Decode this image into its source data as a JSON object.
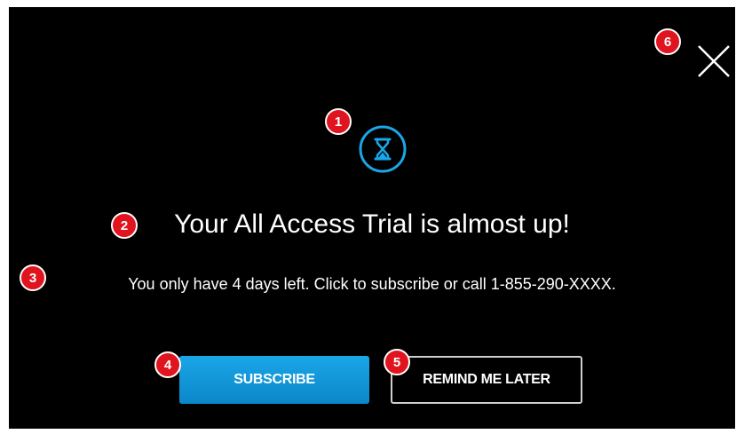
{
  "dialog": {
    "title": "Your All Access Trial is almost up!",
    "message": "You only have 4 days left. Click to subscribe or call 1-855-290-XXXX.",
    "icon": "hourglass-icon",
    "accent_color": "#1aa6e8"
  },
  "buttons": {
    "subscribe_label": "SUBSCRIBE",
    "remind_label": "REMIND ME LATER",
    "close_icon": "close-icon"
  },
  "markers": [
    "1",
    "2",
    "3",
    "4",
    "5",
    "6"
  ]
}
